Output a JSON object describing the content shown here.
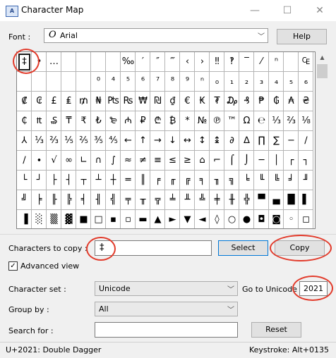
{
  "window": {
    "title": "Character Map",
    "icon_text": "A"
  },
  "font": {
    "label": "Font :",
    "value": "Arial",
    "icon": "O"
  },
  "help_label": "Help",
  "grid_rows": [
    [
      "‡",
      "•",
      "…",
      "",
      "",
      "",
      "",
      "‰",
      "′",
      "″",
      "‴",
      "‹",
      "›",
      "‼",
      "‽",
      "‾",
      "⁄",
      "ⁿ",
      "",
      "₠"
    ],
    [
      "",
      "",
      "",
      "",
      "",
      "⁰",
      "⁴",
      "⁵",
      "⁶",
      "⁷",
      "⁸",
      "⁹",
      "ⁿ",
      "₀",
      "₁",
      "₂",
      "₃",
      "₄",
      "₅",
      "₆"
    ],
    [
      "₡",
      "₢",
      "£",
      "₤",
      "₥",
      "₦",
      "₧",
      "₨",
      "₩",
      "₪",
      "₫",
      "€",
      "₭",
      "₮",
      "₯",
      "₰",
      "₱",
      "₲",
      "₳",
      "₴"
    ],
    [
      "₵",
      "₶",
      "₷",
      "₸",
      "₹",
      "₺",
      "₻",
      "₼",
      "₽",
      "₾",
      "₿",
      "*",
      "№",
      "℗",
      "™",
      "Ω",
      "℮",
      "⅓",
      "⅔",
      "⅛"
    ],
    [
      "⅄",
      "⅓",
      "⅔",
      "⅕",
      "⅖",
      "⅗",
      "⅘",
      "←",
      "↑",
      "→",
      "↓",
      "↔",
      "↕",
      "↨",
      "∂",
      "∆",
      "∏",
      "∑",
      "−",
      "∕"
    ],
    [
      "∕",
      "∙",
      "√",
      "∞",
      "∟",
      "∩",
      "∫",
      "≈",
      "≠",
      "≡",
      "≤",
      "≥",
      "⌂",
      "⌐",
      "⌠",
      "⌡",
      "─",
      "│",
      "┌",
      "┐"
    ],
    [
      "└",
      "┘",
      "├",
      "┤",
      "┬",
      "┴",
      "┼",
      "═",
      "║",
      "╒",
      "╓",
      "╔",
      "╕",
      "╖",
      "╗",
      "╘",
      "╙",
      "╚",
      "╛",
      "╜"
    ],
    [
      "╝",
      "╞",
      "╟",
      "╠",
      "╡",
      "╢",
      "╣",
      "╤",
      "╥",
      "╦",
      "╧",
      "╨",
      "╩",
      "╪",
      "╫",
      "╬",
      "▀",
      "▄",
      "█",
      "▌"
    ],
    [
      "▐",
      "░",
      "▒",
      "▓",
      "■",
      "□",
      "▪",
      "▫",
      "▬",
      "▲",
      "►",
      "▼",
      "◄",
      "◊",
      "○",
      "●",
      "◘",
      "◙",
      "◦",
      "◻"
    ],
    [
      "☺",
      "☻",
      "☼",
      "♀",
      "♂",
      "♠",
      "♣",
      "♥",
      "♦",
      "♪",
      "♫",
      "♯",
      "₸",
      "₹",
      "₺",
      "₻",
      "₼",
      "₽",
      "₾",
      "₿"
    ]
  ],
  "selected_char": "‡",
  "copy": {
    "label": "Characters to copy :",
    "value": "‡",
    "select_label": "Select",
    "copy_label": "Copy"
  },
  "advanced": {
    "label": "Advanced view",
    "checked": "✓"
  },
  "charset": {
    "label": "Character set :",
    "value": "Unicode"
  },
  "goto": {
    "label": "Go to Unicode :",
    "value": "2021"
  },
  "groupby": {
    "label": "Group by :",
    "value": "All"
  },
  "search": {
    "label": "Search for :",
    "value": "",
    "reset_label": "Reset"
  },
  "status": {
    "left": "U+2021: Double Dagger",
    "right": "Keystroke: Alt+0135"
  },
  "accent": "#e23a2a"
}
